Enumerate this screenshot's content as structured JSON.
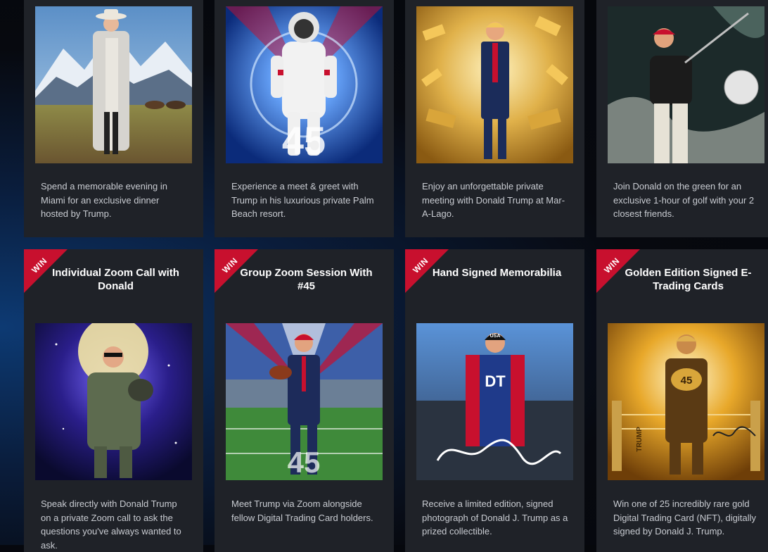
{
  "top_cards": [
    {
      "description": "Spend a memorable evening in Miami for an exclusive dinner hosted by Trump."
    },
    {
      "description": "Experience a meet & greet with Trump in his luxurious private Palm Beach resort."
    },
    {
      "description": "Enjoy an unforgettable private meeting with Donald Trump at Mar-A-Lago."
    },
    {
      "description": "Join Donald on the green for an exclusive 1-hour of golf with your 2 closest friends."
    }
  ],
  "win_cards": [
    {
      "badge": "WIN",
      "title": "Individual Zoom Call with Donald",
      "description": "Speak directly with Donald Trump on a private Zoom call to ask the questions you've always wanted to ask."
    },
    {
      "badge": "WIN",
      "title": "Group Zoom Session With #45",
      "description": "Meet Trump via Zoom alongside fellow Digital Trading Card holders."
    },
    {
      "badge": "WIN",
      "title": "Hand Signed Memorabilia",
      "description": "Receive a limited edition, signed photograph of Donald J. Trump as a prized collectible."
    },
    {
      "badge": "WIN",
      "title": "Golden Edition Signed E-Trading Cards",
      "description": "Win one of 25 incredibly rare gold Digital Trading Card (NFT), digitally signed by Donald J. Trump."
    }
  ],
  "image_text": {
    "astronaut_number": "45",
    "football_number": "45",
    "usa_cap": "USA",
    "racing_bib": "DT",
    "gold_number": "45",
    "ring_text": "TRUMP"
  }
}
